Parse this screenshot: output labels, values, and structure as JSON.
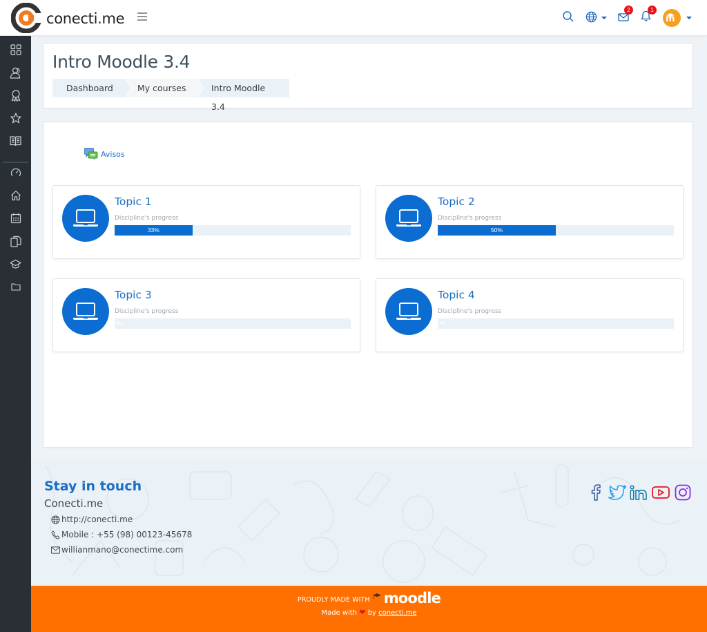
{
  "header": {
    "brand_name": "conecti.me",
    "menu_toggle_icon": "hamburger-icon",
    "search_icon": "search-icon",
    "language_icon": "globe-icon",
    "messages": {
      "icon": "envelope-icon",
      "count": "2"
    },
    "notifications": {
      "icon": "bell-icon",
      "count": "1"
    },
    "user": {
      "avatar_initials": "m",
      "avatar_color": "#f5a021"
    }
  },
  "sidebar": {
    "items": [
      {
        "name": "dashboard",
        "icon": "grid-icon"
      },
      {
        "name": "participants",
        "icon": "users-icon"
      },
      {
        "name": "badges",
        "icon": "award-icon"
      },
      {
        "name": "competencies",
        "icon": "star-icon"
      },
      {
        "name": "grades",
        "icon": "book-icon"
      },
      {
        "name": "dashboard-main",
        "icon": "gauge-icon"
      },
      {
        "name": "site-home",
        "icon": "home-icon"
      },
      {
        "name": "calendar",
        "icon": "calendar-icon"
      },
      {
        "name": "private-files",
        "icon": "files-icon"
      },
      {
        "name": "my-courses",
        "icon": "graduation-cap-icon"
      },
      {
        "name": "course-folder",
        "icon": "folder-icon"
      }
    ]
  },
  "page": {
    "title": "Intro Moodle 3.4",
    "breadcrumb": [
      {
        "label": "Dashboard"
      },
      {
        "label": "My courses"
      },
      {
        "label": "Intro Moodle 3.4"
      }
    ]
  },
  "course": {
    "forum": {
      "label": "Avisos",
      "icon": "forum-icon"
    },
    "progress_caption": "Discipline's progress",
    "topics": [
      {
        "title": "Topic 1",
        "progress_percent": 33,
        "progress_label": "33%"
      },
      {
        "title": "Topic 2",
        "progress_percent": 50,
        "progress_label": "50%"
      },
      {
        "title": "Topic 3",
        "progress_percent": 0,
        "progress_label": "0%"
      },
      {
        "title": "Topic 4",
        "progress_percent": 0,
        "progress_label": "0%"
      }
    ]
  },
  "footer": {
    "heading": "Stay in touch",
    "company": "Conecti.me",
    "website": "http://conecti.me",
    "phone": "Mobile : +55 (98) 00123-45678",
    "email": "willianmano@conectime.com",
    "social": [
      {
        "name": "facebook",
        "color": "#3b5998"
      },
      {
        "name": "twitter",
        "color": "#1da1f2"
      },
      {
        "name": "linkedin",
        "color": "#0e76a8"
      },
      {
        "name": "youtube",
        "color": "#e3161e"
      },
      {
        "name": "instagram",
        "color": "#8a2be2"
      }
    ],
    "proudly_made_with": "PROUDLY MADE WITH",
    "moodle_word": "moodle",
    "made_with_prefix": "Made with",
    "made_with_by": "by",
    "made_with_link": "conecti.me",
    "bar_color": "#ff7000"
  },
  "colors": {
    "primary": "#0b6cd1",
    "link": "#1a6fc4",
    "sidebar_bg": "#2a2f36",
    "badge": "#e3161e"
  }
}
